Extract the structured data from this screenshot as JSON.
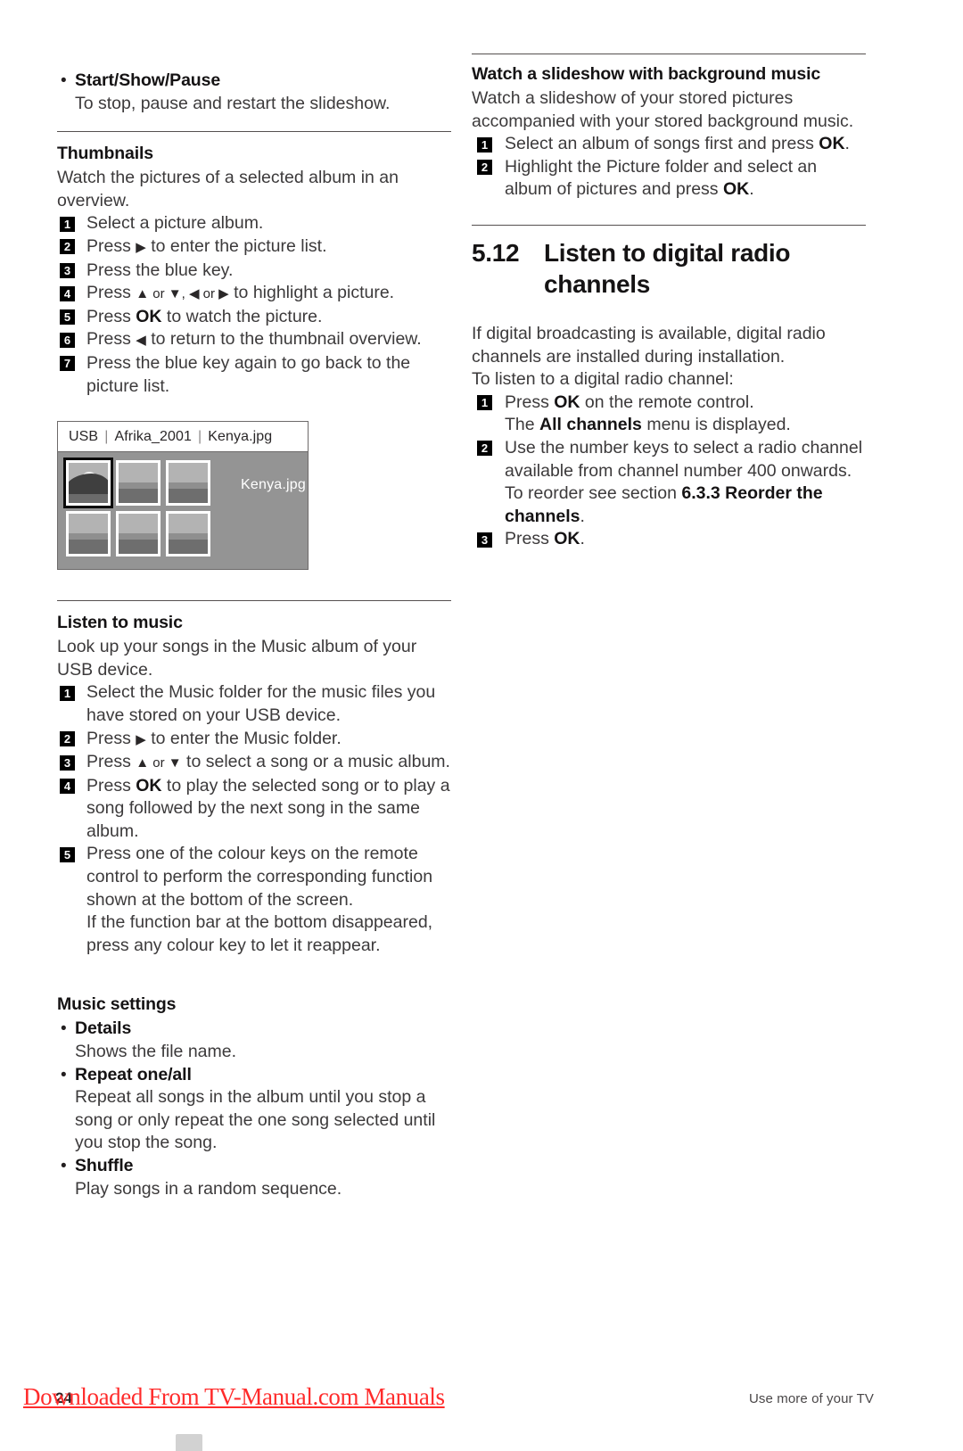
{
  "page": {
    "number": "24",
    "footer_right": "Use more of your TV",
    "watermark": "Downloaded From TV-Manual.com Manuals"
  },
  "left_column": {
    "start_show_pause": {
      "label": "Start/Show/Pause",
      "desc": "To stop, pause and restart the slideshow."
    },
    "thumbnails": {
      "heading": "Thumbnails",
      "intro": "Watch the pictures of a selected album in an overview.",
      "steps": [
        {
          "n": "1",
          "pre": "Select a picture album.",
          "bold": "",
          "post": ""
        },
        {
          "n": "2",
          "pre": "Press ",
          "arrow": "▶",
          "post": " to enter the picture list."
        },
        {
          "n": "3",
          "pre": "Press the blue key."
        },
        {
          "n": "4",
          "pre": "Press ",
          "arrows": "▲ or ▼, ◀ or ▶",
          "post": " to highlight a picture."
        },
        {
          "n": "5",
          "pre": "Press ",
          "bold": "OK",
          "post": " to watch the picture."
        },
        {
          "n": "6",
          "pre": "Press ",
          "arrow": "◀",
          "post": " to return to the thumbnail overview."
        },
        {
          "n": "7",
          "pre": "Press the blue key again to go back to the picture list."
        }
      ]
    },
    "figure": {
      "breadcrumb": [
        "USB",
        "Afrika_2001",
        "Kenya.jpg"
      ],
      "selected_file_label": "Kenya.jpg",
      "thumb_count": 6,
      "selected_index": 0
    },
    "listen_to_music": {
      "heading": "Listen to music",
      "intro": "Look up your songs in the Music album of your USB device.",
      "steps": [
        {
          "n": "1",
          "text": "Select the Music folder for the music files you have stored on your USB device."
        },
        {
          "n": "2",
          "pre": "Press ",
          "arrow": "▶",
          "post": " to enter the Music folder."
        },
        {
          "n": "3",
          "pre": "Press ",
          "arrows": "▲ or ▼",
          "post": " to select a song or a music album."
        },
        {
          "n": "4",
          "pre": "Press ",
          "bold": "OK",
          "post": " to play the selected song or to play a song followed by the next song in the same album."
        },
        {
          "n": "5",
          "text": "Press one of the colour keys on the remote control to perform the corresponding function shown at the bottom of the screen.",
          "text2": "If the function bar at the bottom disappeared, press any colour key to let it reappear."
        }
      ]
    },
    "music_settings": {
      "heading": "Music settings",
      "items": [
        {
          "label": "Details",
          "desc": "Shows the file name."
        },
        {
          "label": "Repeat one/all",
          "desc": "Repeat all songs in the album until you stop a song or only repeat the one song selected until you stop the song."
        },
        {
          "label": "Shuffle",
          "desc": "Play songs in a random sequence."
        }
      ]
    }
  },
  "right_column": {
    "slideshow_music": {
      "heading": "Watch a slideshow with background music",
      "intro": "Watch a slideshow of your stored pictures accompanied with your stored background music.",
      "steps": [
        {
          "n": "1",
          "pre": "Select an album of songs first and press ",
          "bold": "OK",
          "post": "."
        },
        {
          "n": "2",
          "pre": "Highlight the Picture folder and select an album of pictures and press ",
          "bold": "OK",
          "post": "."
        }
      ]
    },
    "section": {
      "number": "5.12",
      "title": "Listen to digital radio channels",
      "intro1": "If digital broadcasting is available, digital radio channels are installed during installation.",
      "intro2": "To listen to a digital radio channel:",
      "steps": [
        {
          "n": "1",
          "pre": "Press ",
          "bold": "OK",
          "post": " on the remote control.",
          "line2_pre": "The ",
          "line2_bold": "All channels",
          "line2_post": " menu is displayed."
        },
        {
          "n": "2",
          "pre": "Use the number keys to select a radio channel available from channel number 400 onwards.",
          "line2_pre": "To reorder see section ",
          "line2_bold": "6.3.3 Reorder the channels",
          "line2_post": "."
        },
        {
          "n": "3",
          "pre": "Press ",
          "bold": "OK",
          "post": "."
        }
      ]
    }
  }
}
